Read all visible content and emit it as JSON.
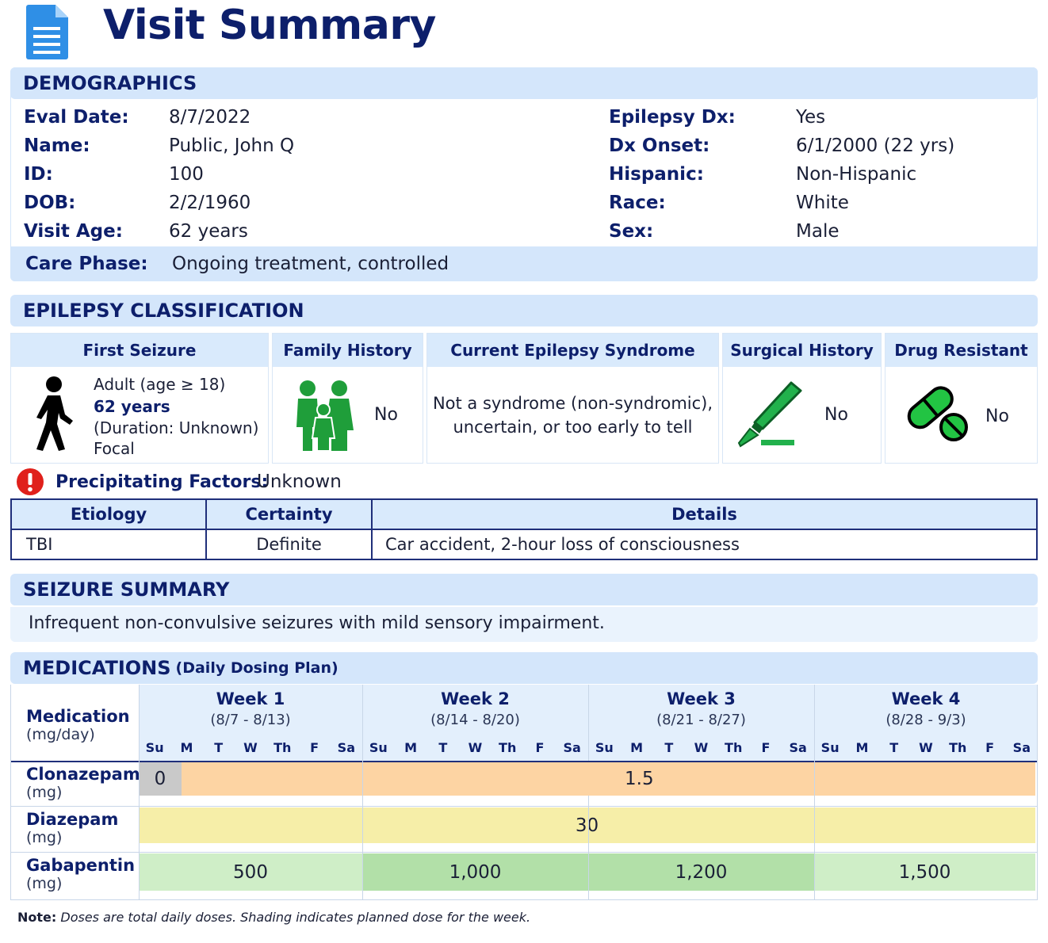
{
  "title": "Visit Summary",
  "demographics": {
    "header": "DEMOGRAPHICS",
    "left": [
      {
        "label": "Eval Date:",
        "value": "8/7/2022"
      },
      {
        "label": "Name:",
        "value": "Public, John Q"
      },
      {
        "label": "ID:",
        "value": "100"
      },
      {
        "label": "DOB:",
        "value": "2/2/1960"
      },
      {
        "label": "Visit Age:",
        "value": "62 years"
      }
    ],
    "right": [
      {
        "label": "Epilepsy Dx:",
        "value": "Yes"
      },
      {
        "label": "Dx Onset:",
        "value": "6/1/2000 (22 yrs)"
      },
      {
        "label": "Hispanic:",
        "value": "Non-Hispanic"
      },
      {
        "label": "Race:",
        "value": "White"
      },
      {
        "label": "Sex:",
        "value": "Male"
      }
    ],
    "care_phase_label": "Care Phase:",
    "care_phase_value": "Ongoing treatment, controlled"
  },
  "classification": {
    "header": "EPILEPSY CLASSIFICATION",
    "first_seizure": {
      "title": "First Seizure",
      "line1": "Adult (age ≥ 18)",
      "line2": "62 years",
      "line3": "(Duration: Unknown)",
      "line4": "Focal",
      "icon": "walking-person-icon"
    },
    "family_history": {
      "title": "Family History",
      "value": "No",
      "icon": "family-icon"
    },
    "syndrome": {
      "title": "Current Epilepsy Syndrome",
      "line1": "Not a syndrome (non-syndromic),",
      "line2": "uncertain, or too early to tell"
    },
    "surgical_history": {
      "title": "Surgical History",
      "value": "No",
      "icon": "scalpel-icon"
    },
    "drug_resistant": {
      "title": "Drug Resistant",
      "value": "No",
      "icon": "pills-icon"
    },
    "precipitating_label": "Precipitating Factors:",
    "precipitating_value": "Unknown",
    "etiology_headers": [
      "Etiology",
      "Certainty",
      "Details"
    ],
    "etiology_rows": [
      [
        "TBI",
        "Definite",
        "Car accident, 2-hour loss of consciousness"
      ]
    ]
  },
  "seizure_summary": {
    "header": "SEIZURE SUMMARY",
    "text": "Infrequent non-convulsive seizures with mild sensory impairment."
  },
  "medications": {
    "header": "MEDICATIONS",
    "subheader": "(Daily Dosing Plan)",
    "col_label": "Medication",
    "col_unit": "(mg/day)",
    "weeks": [
      {
        "label": "Week 1",
        "range": "(8/7 - 8/13)"
      },
      {
        "label": "Week 2",
        "range": "(8/14 - 8/20)"
      },
      {
        "label": "Week 3",
        "range": "(8/21 - 8/27)"
      },
      {
        "label": "Week 4",
        "range": "(8/28 - 9/3)"
      }
    ],
    "days": [
      "Su",
      "M",
      "T",
      "W",
      "Th",
      "F",
      "Sa"
    ],
    "rows": [
      {
        "name": "Clonazepam",
        "unit": "(mg)",
        "first_day": "0",
        "value": "1.5"
      },
      {
        "name": "Diazepam",
        "unit": "(mg)",
        "value": "30"
      },
      {
        "name": "Gabapentin",
        "unit": "(mg)",
        "weekly": [
          "500",
          "1,000",
          "1,200",
          "1,500"
        ]
      }
    ],
    "note_label": "Note:",
    "note_text": "Doses are total daily doses. Shading indicates planned dose for the week.",
    "colors": {
      "clonazepam": "#fdd4a3",
      "zero": "#c9c9c9",
      "diazepam": "#f6eea8",
      "gaba_light": "#cfeec7",
      "gaba_mid": "#b2e0a8"
    }
  }
}
